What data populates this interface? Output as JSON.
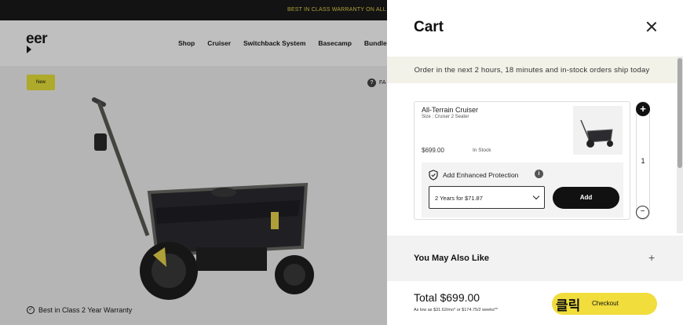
{
  "promo": {
    "text": "BEST IN CLASS WARRANTY ON ALL VEER C"
  },
  "site": {
    "logo": "eer",
    "nav": [
      "Shop",
      "Cruiser",
      "Switchback System",
      "Basecamp",
      "Bundles"
    ],
    "badge": "New",
    "faq": "FA",
    "warranty": "Best in Class 2 Year Warranty"
  },
  "cart": {
    "title": "Cart",
    "shipping_banner": "Order in the next 2 hours, 18 minutes and in-stock orders ship today",
    "item": {
      "name": "All-Terrain Cruiser",
      "size": "Size : Cruiser 2 Seater",
      "price": "$699.00",
      "stock": "In Stock",
      "quantity": "1"
    },
    "protection": {
      "label": "Add Enhanced Protection",
      "selected_plan": "2 Years for $71.87",
      "add_label": "Add"
    },
    "also_like": "You May Also Like",
    "total": "Total $699.00",
    "installments": "As low as $31.62/mo* or $174.75/2 weeks**",
    "checkout": {
      "korean": "클릭",
      "label": "Checkout"
    }
  },
  "colors": {
    "accent_yellow": "#f1dd3c",
    "ship_banner_bg": "#f3f2e9",
    "dark": "#111111"
  }
}
